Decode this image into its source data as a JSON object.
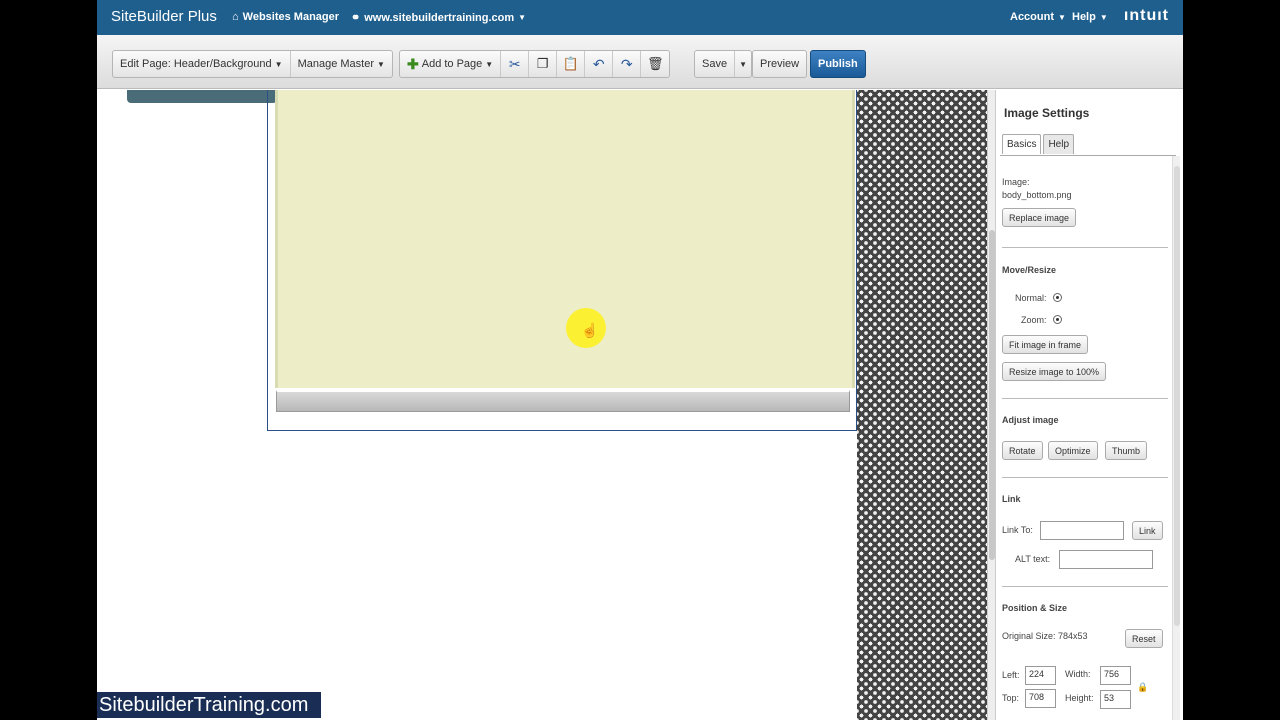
{
  "topbar": {
    "brand": "SiteBuilder Plus",
    "websites_manager": "Websites Manager",
    "site_url": "www.sitebuildertraining.com",
    "account": "Account",
    "help": "Help",
    "intuit": "ıntuıt"
  },
  "toolbar": {
    "edit_page": "Edit Page: Header/Background",
    "manage_master": "Manage Master",
    "add_to_page": "Add to Page",
    "save": "Save",
    "preview": "Preview",
    "publish": "Publish"
  },
  "panel": {
    "title": "Image Settings",
    "tabs": [
      "Basics",
      "Help"
    ],
    "image_label": "Image:",
    "image_name": "body_bottom.png",
    "replace_image": "Replace image",
    "move_resize": "Move/Resize",
    "normal": "Normal:",
    "zoom": "Zoom:",
    "fit_image": "Fit image in frame",
    "resize_image": "Resize image to 100%",
    "adjust_image": "Adjust image",
    "rotate": "Rotate",
    "optimize": "Optimize",
    "thumb": "Thumb",
    "link_head": "Link",
    "link_to": "Link To:",
    "link_btn": "Link",
    "alt_text": "ALT text:",
    "position_size": "Position & Size",
    "original_size": "Original Size: 784x53",
    "reset": "Reset",
    "left_label": "Left:",
    "left_value": "224",
    "width_label": "Width:",
    "width_value": "756",
    "top_label": "Top:",
    "top_value": "708",
    "height_label": "Height:",
    "height_value": "53"
  },
  "watermark": "SitebuilderTraining.com",
  "colors": {
    "topbar": "#1f5f8e",
    "publish": "#1b5a97",
    "canvas_panel": "#edeec8"
  }
}
